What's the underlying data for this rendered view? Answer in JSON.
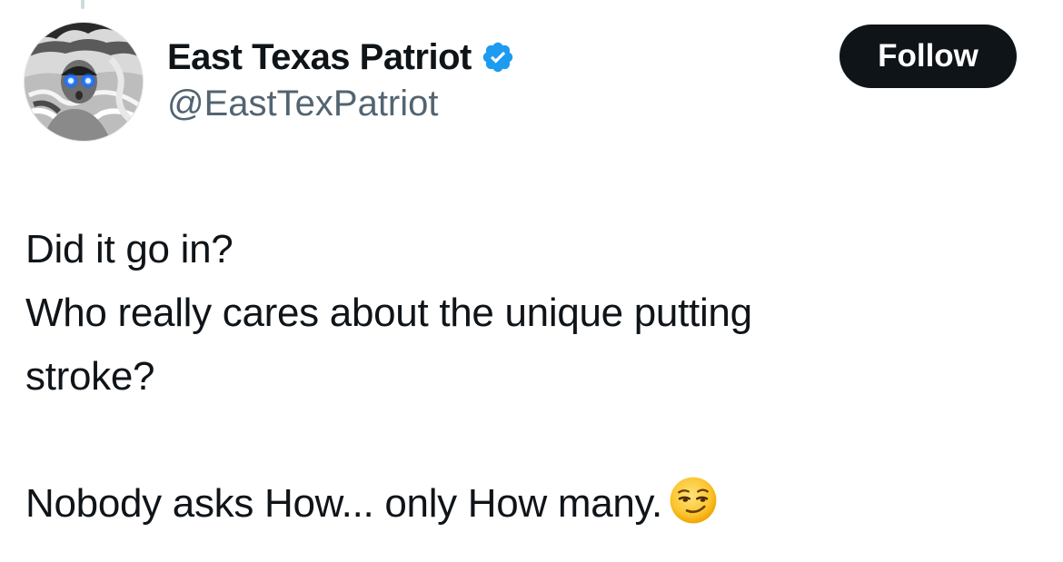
{
  "tweet": {
    "display_name": "East Texas Patriot",
    "handle": "@EastTexPatriot",
    "verified": true,
    "follow_label": "Follow",
    "lines": [
      "Did it go in?",
      "Who really cares about the unique putting",
      "stroke?",
      "",
      "Nobody asks How... only How many."
    ],
    "emoji": "smirking-face"
  },
  "colors": {
    "text": "#0f1419",
    "secondary_text": "#536471",
    "verified_badge": "#1d9bf0",
    "button_bg": "#0f1419",
    "button_text": "#ffffff"
  }
}
